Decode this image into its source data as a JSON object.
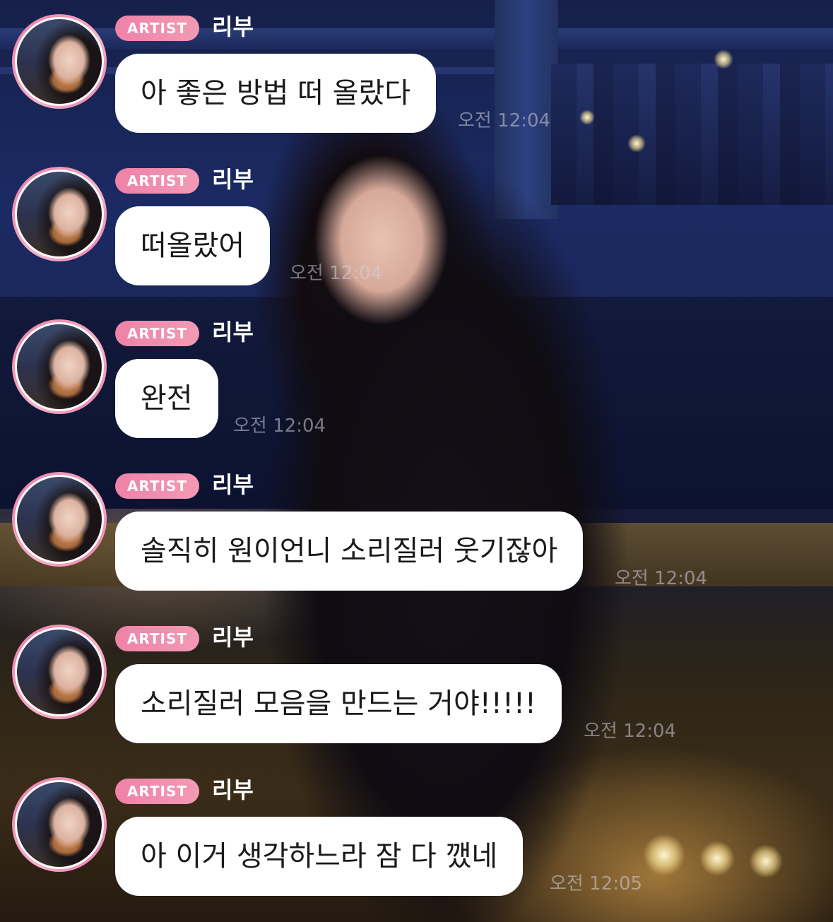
{
  "messages": [
    {
      "badge": "ARTIST",
      "sender": "리부",
      "text": "아 좋은 방법 떠 올랐다",
      "time": "오전 12:04"
    },
    {
      "badge": "ARTIST",
      "sender": "리부",
      "text": "떠올랐어",
      "time": "오전 12:04"
    },
    {
      "badge": "ARTIST",
      "sender": "리부",
      "text": "완전",
      "time": "오전 12:04"
    },
    {
      "badge": "ARTIST",
      "sender": "리부",
      "text": "솔직히 원이언니 소리질러 웃기잖아",
      "time": "오전 12:04"
    },
    {
      "badge": "ARTIST",
      "sender": "리부",
      "text": "소리질러 모음을 만드는 거야!!!!!",
      "time": "오전 12:04"
    },
    {
      "badge": "ARTIST",
      "sender": "리부",
      "text": "아 이거 생각하느라 잠 다 깼네",
      "time": "오전 12:05"
    }
  ],
  "colors": {
    "badge": "#ee82a7",
    "bubble": "#ffffff",
    "avatar_ring": "#e97ba9"
  }
}
